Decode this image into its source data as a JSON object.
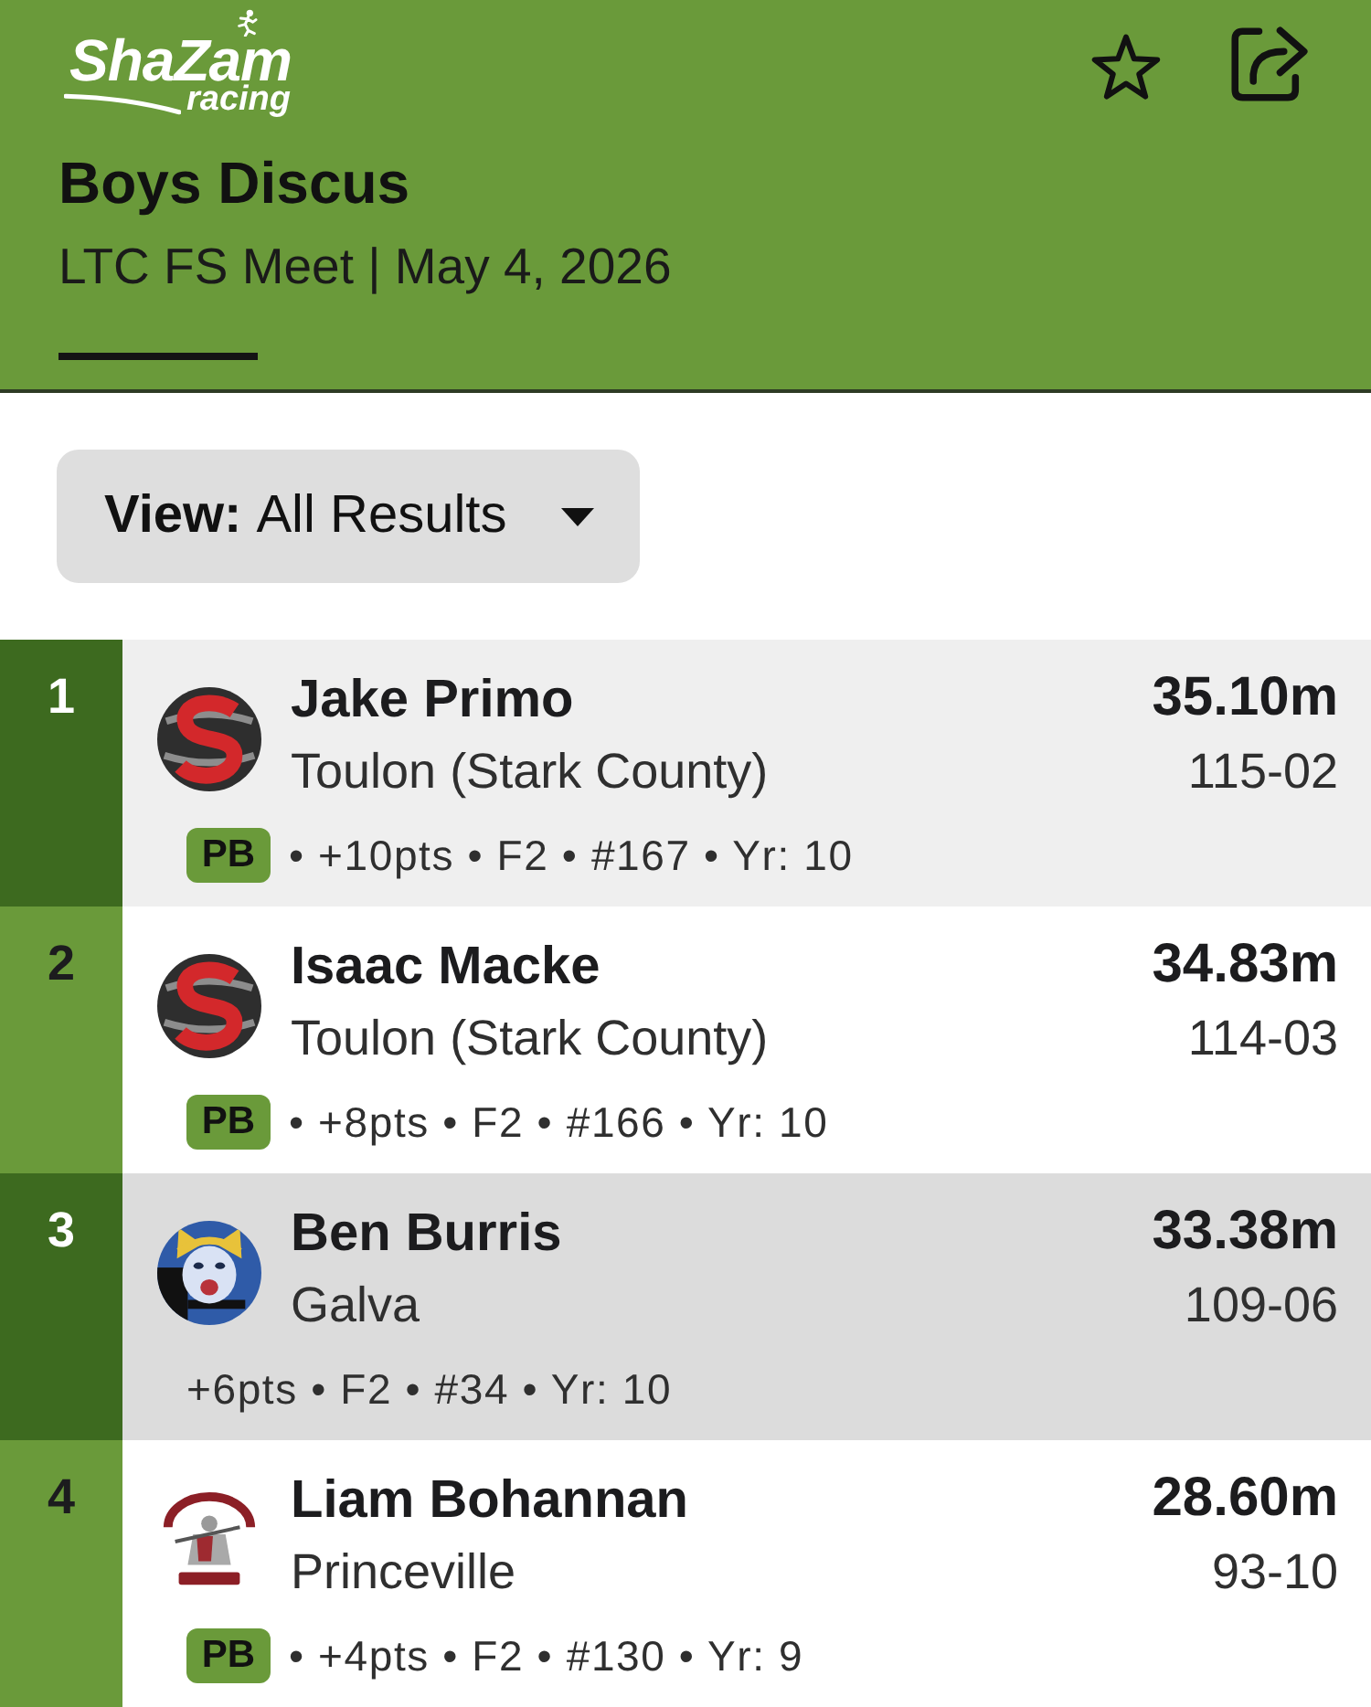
{
  "app_bar": {
    "logo": {
      "wordmark": "ShaZam",
      "tagline": "racing"
    },
    "favorite": false
  },
  "event": {
    "title": "Boys Discus",
    "subtitle": "LTC FS Meet | May 4, 2026"
  },
  "view_filter": {
    "label": "View:",
    "value": "All Results"
  },
  "results": [
    {
      "rank": "1",
      "highlighted": true,
      "selected": false,
      "logo": {
        "kind": "emblem"
      },
      "name": "Jake Primo",
      "team": "Toulon (Stark County)",
      "badge": "PB",
      "details": "• +10pts • F2 • #167 • Yr: 10",
      "mark": "35.10m",
      "mark_imperial": "115-02"
    },
    {
      "rank": "2",
      "highlighted": false,
      "selected": false,
      "logo": {
        "kind": "emblem"
      },
      "name": "Isaac Macke",
      "team": "Toulon (Stark County)",
      "badge": "PB",
      "details": "• +8pts • F2 • #166 • Yr: 10",
      "mark": "34.83m",
      "mark_imperial": "114-03"
    },
    {
      "rank": "3",
      "highlighted": true,
      "selected": true,
      "logo": {
        "kind": "wildcat"
      },
      "name": "Ben Burris",
      "team": "Galva",
      "details": "+6pts • F2 • #34 • Yr: 10",
      "mark": "33.38m",
      "mark_imperial": "109-06"
    },
    {
      "rank": "4",
      "highlighted": false,
      "selected": false,
      "logo": {
        "kind": "knight"
      },
      "name": "Liam Bohannan",
      "team": "Princeville",
      "badge": "PB",
      "details": "• +4pts • F2 • #130 • Yr: 9",
      "mark": "28.60m",
      "mark_imperial": "93-10"
    }
  ]
}
